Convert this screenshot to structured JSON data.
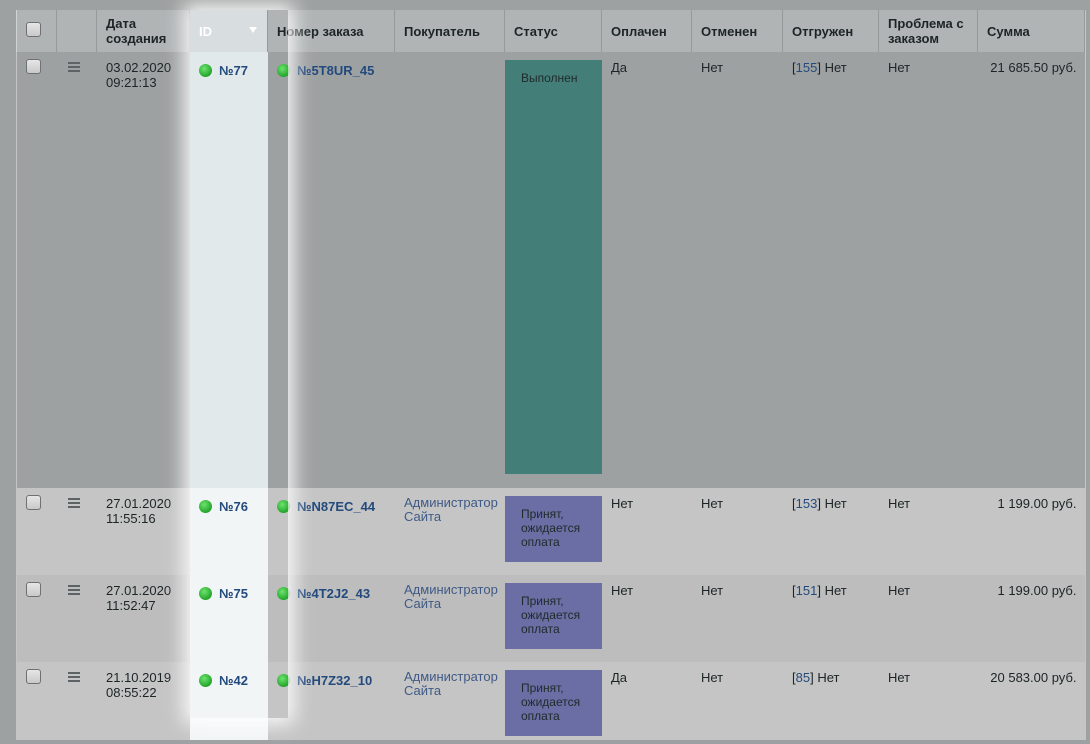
{
  "columns": {
    "select": "",
    "menu": "",
    "created": "Дата создания",
    "id": "ID",
    "order_number": "Номер заказа",
    "buyer": "Покупатель",
    "status": "Статус",
    "paid": "Оплачен",
    "canceled": "Отменен",
    "shipped": "Отгружен",
    "problem": "Проблема с заказом",
    "sum": "Сумма"
  },
  "rows": [
    {
      "date": "03.02.2020",
      "time": "09:21:13",
      "id": "№77",
      "order_number": "№5T8UR_45",
      "buyer_line1": "",
      "buyer_line2": "",
      "status": "Выполнен",
      "paid": "Да",
      "canceled": "Нет",
      "shipment_id": "155",
      "shipped": "Нет",
      "problem": "Нет",
      "sum": "21 685.50 руб."
    },
    {
      "date": "27.01.2020",
      "time": "11:55:16",
      "id": "№76",
      "order_number": "№N87EC_44",
      "buyer_line1": "Администратор",
      "buyer_line2": "Сайта",
      "status": "Принят, ожидается оплата",
      "paid": "Нет",
      "canceled": "Нет",
      "shipment_id": "153",
      "shipped": "Нет",
      "problem": "Нет",
      "sum": "1 199.00 руб."
    },
    {
      "date": "27.01.2020",
      "time": "11:52:47",
      "id": "№75",
      "order_number": "№4T2J2_43",
      "buyer_line1": "Администратор",
      "buyer_line2": "Сайта",
      "status": "Принят, ожидается оплата",
      "paid": "Нет",
      "canceled": "Нет",
      "shipment_id": "151",
      "shipped": "Нет",
      "problem": "Нет",
      "sum": "1 199.00 руб."
    },
    {
      "date": "21.10.2019",
      "time": "08:55:22",
      "id": "№42",
      "order_number": "№H7Z32_10",
      "buyer_line1": "Администратор",
      "buyer_line2": "Сайта",
      "status": "Принят, ожидается оплата",
      "paid": "Да",
      "canceled": "Нет",
      "shipment_id": "85",
      "shipped": "Нет",
      "problem": "Нет",
      "sum": "20 583.00 руб."
    }
  ],
  "icons": {
    "row_menu": "menu-icon",
    "status_indicator": "green-dot-icon",
    "sort": "sort-desc-icon"
  },
  "colors": {
    "status_done": "#447e79",
    "status_wait": "#6a6ea4",
    "link": "#234a7d"
  }
}
